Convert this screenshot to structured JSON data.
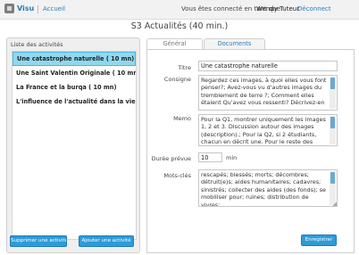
{
  "header": {
    "app_title": "Visu",
    "home_link": "Accueil",
    "connected_as": "Vous êtes connecté en tant que:",
    "user_name": "Wendy Tuteur",
    "logout": "Déconnect"
  },
  "page_title": "S3 Actualités (40 min.)",
  "activities": {
    "header": "Liste des activités",
    "items": [
      "Une catastrophe naturelle ( 10 mn)",
      "Une Saint Valentin Originale ( 10 mn)",
      "La France et la burqa ( 10 mn)",
      "L'influence de l'actualité dans la vie q..."
    ],
    "selected_index": 0,
    "delete_button": "Supprimer une activité",
    "add_button": "Ajouter une activité"
  },
  "tabs": [
    "Général",
    "Documents"
  ],
  "active_tab": 0,
  "form": {
    "title_label": "Titre",
    "title_value": "Une catastrophe naturelle",
    "consigne_label": "Consigne",
    "consigne_value": "Regardez ces images, à quoi elles vous font penser?; Avez-vous vu d'autres images du tremblement de terre ?; Comment elles étaient Qu'avez vous ressenti? Décrivez-en",
    "memo_label": "Memo",
    "memo_value": "Pour la Q1, montrer uniquement les images 1, 2 et 3. Discussion autour des images (description).; Pour la Q2, si 2 étudiants, chacun en décrit une. Pour le reste des",
    "duree_label": "Durée prévue",
    "duree_value": "10",
    "duree_unit": "min",
    "mots_label": "Mots-clés",
    "mots_value": "rescapés; blessés; morts; décombres; détruit(e)s; aides humanitaires; cadavres; sinistrés; collecter des aides (des fonds); se mobiliser pour; ruines; distribution de vivres;",
    "save_button": "Enregistrer"
  }
}
